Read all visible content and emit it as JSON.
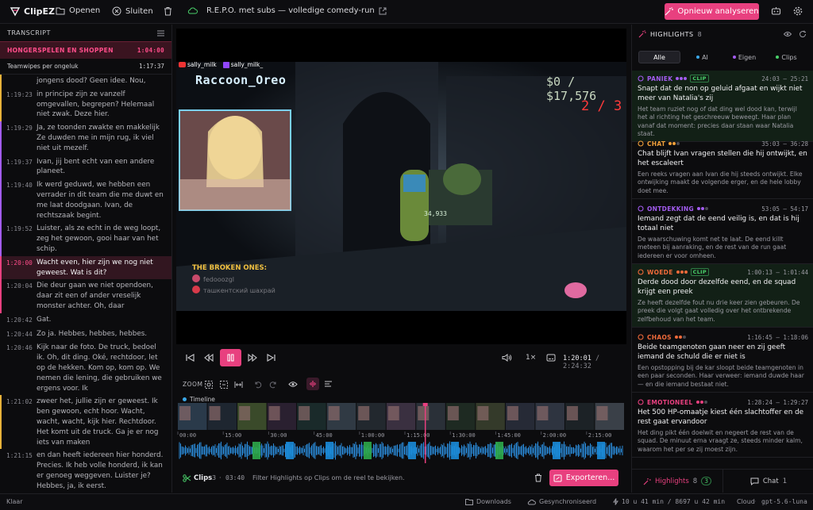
{
  "app": {
    "name": "ClipEZ"
  },
  "topbar": {
    "open": "Openen",
    "close": "Sluiten",
    "project_title": "R.E.P.O. met subs — volledige comedy-run",
    "reanalyze": "Opnieuw analyseren"
  },
  "transcript": {
    "header": "TRANSCRIPT",
    "chapter": {
      "title": "HONGERSPELEN EN SHOPPEN",
      "time": "1:04:00"
    },
    "subchapter": {
      "title": "Teamwipes per ongeluk",
      "time": "1:17:37"
    },
    "rows": [
      {
        "time": "",
        "text": "jongens dood? Geen idee. Nou,",
        "bar": "#e8b23a"
      },
      {
        "time": "1:19:23",
        "text": "in principe zijn ze vanzelf omgevallen, begrepen? Helemaal niet zwak. Deze hier.",
        "bar": "#e8b23a"
      },
      {
        "time": "1:19:29",
        "text": "Ja, ze toonden zwakte en makkelijk Ze duwden me in mijn rug, ik viel niet uit mezelf.",
        "bar": "#a35cf0"
      },
      {
        "time": "1:19:37",
        "text": "Ivan, jij bent echt van een andere planeet.",
        "bar": "#a35cf0"
      },
      {
        "time": "1:19:40",
        "text": "Ik werd geduwd, we hebben een verrader in dit team die me duwt en me laat doodgaan. Ivan, de rechtszaak begint.",
        "bar": "#a35cf0"
      },
      {
        "time": "1:19:52",
        "text": "Luister, als ze echt in de weg loopt, zeg het gewoon, gooi haar van het schip.",
        "bar": "#a35cf0"
      },
      {
        "time": "1:20:00",
        "text": "Wacht even, hier zijn we nog niet geweest. Wat is dit?",
        "bar": "#e8407f",
        "active": true
      },
      {
        "time": "1:20:04",
        "text": "Die deur gaan we niet opendoen, daar zit een of ander vreselijk monster achter. Oh, daar",
        "bar": "#e8407f"
      },
      {
        "time": "1:20:42",
        "text": "Gat.",
        "bar": ""
      },
      {
        "time": "1:20:44",
        "text": "Zo ja. Hebbes, hebbes, hebbes.",
        "bar": ""
      },
      {
        "time": "1:20:46",
        "text": "Kijk naar de foto. De truck, bedoel ik. Oh, dit ding. Oké, rechtdoor, let op de hekken. Kom op, kom op. We nemen die lening, die gebruiken we ergens voor. Ik",
        "bar": ""
      },
      {
        "time": "1:21:02",
        "text": "zweer het, jullie zijn er geweest. Ik ben gewoon, echt hoor. Wacht, wacht, wacht, kijk hier. Rechtdoor. Het komt uit de truck. Ga je er nog iets van maken",
        "bar": "#e8b23a"
      },
      {
        "time": "1:21:15",
        "text": "en dan heeft iedereen hier honderd. Precies. Ik heb volle honderd, ik kan er genoeg weggeven. Luister je? Hebbes, ja, ik eerst.",
        "bar": ""
      }
    ]
  },
  "video": {
    "streamer_yt": "sally_milk",
    "streamer_tw": "sally_milk_",
    "overlay_name": "Raccoon_Oreo",
    "money": "$0 / $17,576",
    "wave": "2 / 3",
    "team_title": "THE BROKEN ONES:",
    "team_members": [
      "fedooozgl",
      "ташкентский шахрай"
    ],
    "item_value": "34,933"
  },
  "controls": {
    "speed": "1×",
    "current_time": "1:20:01",
    "total_time": "2:24:32"
  },
  "zoom": {
    "label": "ZOOM"
  },
  "timeline": {
    "label": "Timeline",
    "ticks": [
      "00:00",
      "15:00",
      "30:00",
      "45:00",
      "1:00:00",
      "1:15:00",
      "1:30:00",
      "1:45:00",
      "2:00:00",
      "2:15:00"
    ],
    "playhead": 0.554
  },
  "footer": {
    "clips_label": "Clips",
    "clips_count": "3",
    "clips_duration": "03:40",
    "hint": "Filter Highlights op Clips om de reel te bekijken.",
    "export": "Exporteren..."
  },
  "highlights": {
    "header": "HIGHLIGHTS",
    "count": "8",
    "tabs": [
      {
        "label": "Alle",
        "dot": ""
      },
      {
        "label": "AI",
        "dot": "#3aa8e8"
      },
      {
        "label": "Eigen",
        "dot": "#a35cf0"
      },
      {
        "label": "Clips",
        "dot": "#49d06a"
      }
    ],
    "cards": [
      {
        "category": "PANIEK",
        "color": "#a35cf0",
        "clip": "CLIP",
        "time": "24:03 — 25:21",
        "title": "Snapt dat de non op geluid afgaat en wijkt niet meer van Natalia's zij",
        "desc": "Het team ruziet nog of dat ding wel dood kan, terwijl het al richting het geschreeuw beweegt. Haar plan vanaf dat moment: precies daar staan waar Natalia staat."
      },
      {
        "category": "CHAT",
        "color": "#f0a03a",
        "clip": "",
        "time": "35:03 — 36:28",
        "title": "Chat blijft Ivan vragen stellen die hij ontwijkt, en het escaleert",
        "desc": "Een reeks vragen aan Ivan die hij steeds ontwijkt. Elke ontwijking maakt de volgende erger, en de hele lobby doet mee."
      },
      {
        "category": "ONTDEKKING",
        "color": "#a35cf0",
        "clip": "",
        "time": "53:05 — 54:17",
        "title": "Iemand zegt dat de eend veilig is, en dat is hij totaal niet",
        "desc": "De waarschuwing komt net te laat. De eend killt meteen bij aanraking, en de rest van de run gaat iedereen er voor omheen."
      },
      {
        "category": "WOEDE",
        "color": "#f06a3a",
        "clip": "CLIP",
        "time": "1:00:13 — 1:01:44",
        "title": "Derde dood door dezelfde eend, en de squad krijgt een preek",
        "desc": "Ze heeft dezelfde fout nu drie keer zien gebeuren. De preek die volgt gaat volledig over het ontbrekende zelfbehoud van het team."
      },
      {
        "category": "CHAOS",
        "color": "#f06a3a",
        "clip": "",
        "time": "1:16:45 — 1:18:06",
        "title": "Beide teamgenoten gaan neer en zij geeft iemand de schuld die er niet is",
        "desc": "Een opstopping bij de kar sloopt beide teamgenoten in een paar seconden. Haar verweer: iemand duwde haar — en die iemand bestaat niet."
      },
      {
        "category": "EMOTIONEEL",
        "color": "#e8407f",
        "clip": "",
        "time": "1:28:24 — 1:29:27",
        "title": "Het 500 HP-omaatje kiest één slachtoffer en de rest gaat ervandoor",
        "desc": "Het ding pikt één doelwit en negeert de rest van de squad. De minuut erna vraagt ze, steeds minder kalm, waarom het per se zij moest zijn."
      }
    ],
    "bottom": {
      "highlights_label": "Highlights",
      "highlights_count": "8",
      "clips_count": "3",
      "chat_label": "Chat",
      "chat_count": "1"
    }
  },
  "statusbar": {
    "left": "Klaar",
    "downloads": "Downloads",
    "sync": "Gesynchroniseerd",
    "stats": "10 u 41 min / 8697 u 42 min",
    "mode": "Cloud",
    "model": "gpt-5.6-luna"
  }
}
